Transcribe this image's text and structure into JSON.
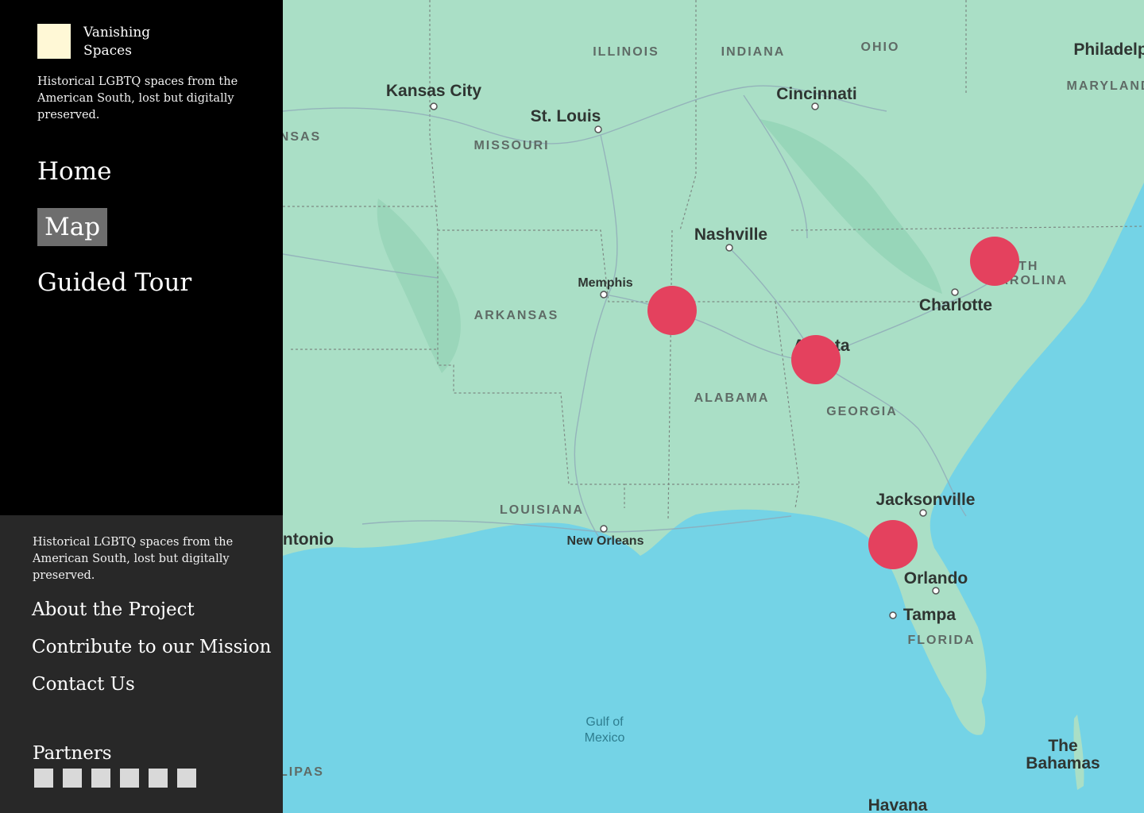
{
  "brand": {
    "name": "Vanishing Spaces",
    "tagline": "Historical LGBTQ spaces from the American South, lost but digitally preserved."
  },
  "nav": {
    "items": [
      {
        "label": "Home",
        "active": false
      },
      {
        "label": "Map",
        "active": true
      },
      {
        "label": "Guided Tour",
        "active": false
      }
    ]
  },
  "footer": {
    "tagline": "Historical LGBTQ spaces from the American South, lost but digitally preserved.",
    "links": [
      "About the Project",
      "Contribute to our Mission",
      "Contact Us"
    ],
    "partners_title": "Partners",
    "partner_count": 6
  },
  "map": {
    "state_labels": [
      "ILLINOIS",
      "INDIANA",
      "OHIO",
      "MARYLAND",
      "MISSOURI",
      "ARKANSAS",
      "ALABAMA",
      "GEORGIA",
      "LOUISIANA",
      "FLORIDA",
      "NSAS",
      "RTH",
      "CAROLINA",
      "LIPAS"
    ],
    "city_labels": [
      "Kansas City",
      "St. Louis",
      "Cincinnati",
      "Philadelp",
      "Nashville",
      "Memphis",
      "Charlotte",
      "Atlanta",
      "Jacksonville",
      "New Orleans",
      "Orlando",
      "Tampa",
      "ntonio",
      "Havana"
    ],
    "water_labels": [
      "Gulf of\nMexico",
      "The\nBahamas"
    ],
    "marker_count": 4
  },
  "colors": {
    "sidebar_bg": "#000000",
    "footer_bg": "#282828",
    "active_nav_bg": "#6e6e6e",
    "logo": "#fff8d6",
    "land": "#aadfc6",
    "water": "#74d3e6",
    "marker": "#e4415e"
  }
}
